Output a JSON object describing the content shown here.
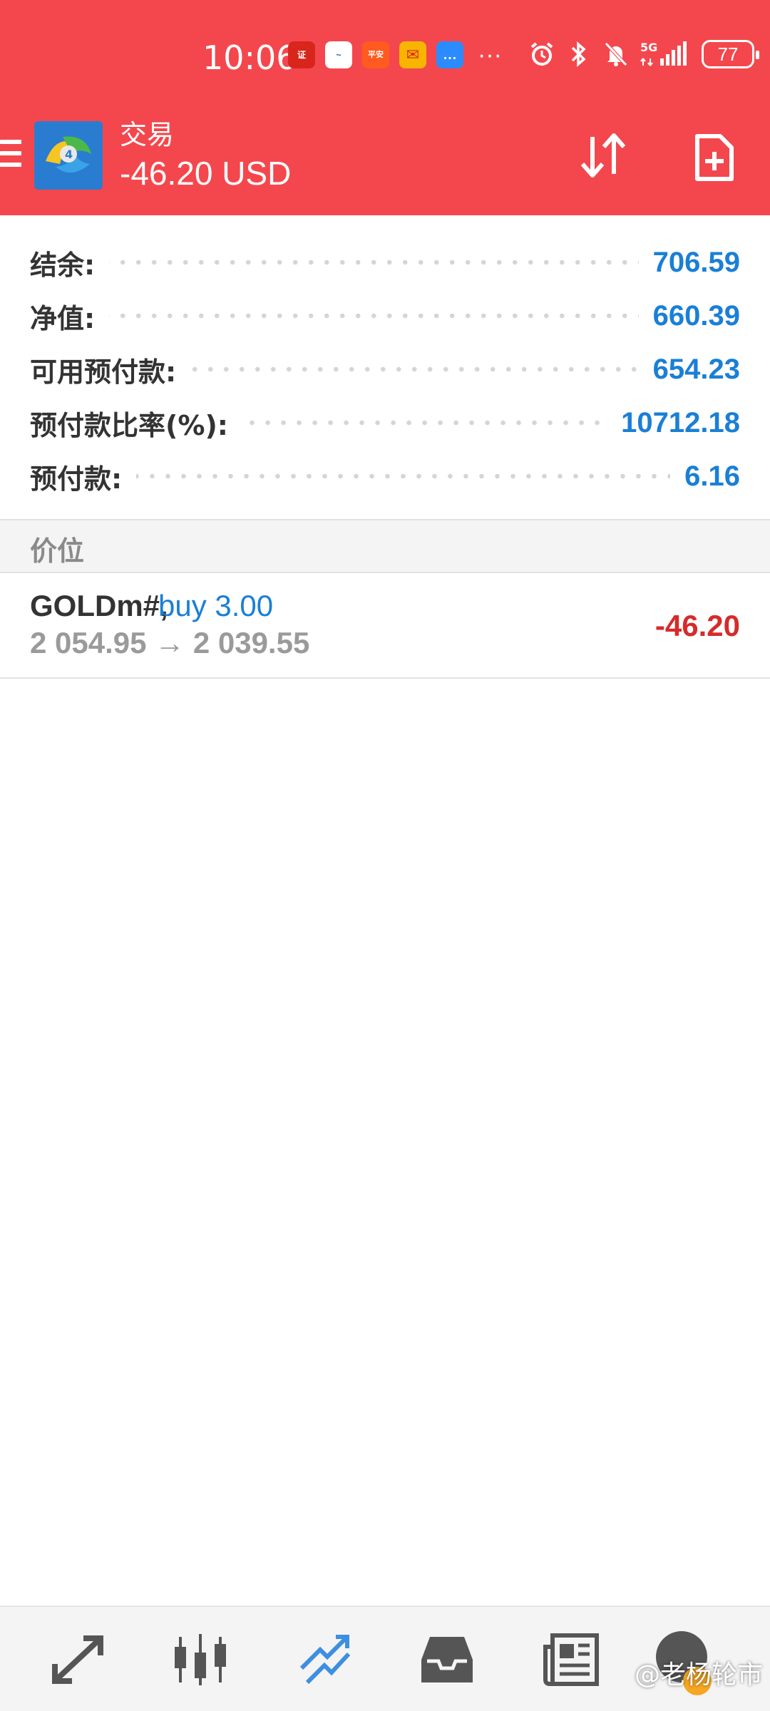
{
  "status_bar": {
    "time": "10:06",
    "notif_apps": [
      {
        "name": "app-securities",
        "color": "#d9261c",
        "glyph": "证"
      },
      {
        "name": "app-chart",
        "color": "#ffffff",
        "glyph": "~"
      },
      {
        "name": "app-pingan-bank",
        "color": "#ff5a1f",
        "glyph": "平安"
      },
      {
        "name": "app-mail",
        "color": "#f7b500",
        "glyph": "✉"
      },
      {
        "name": "app-messages",
        "color": "#2a8cff",
        "glyph": "…"
      }
    ],
    "more_notifications": "···",
    "network": "5G",
    "battery": "77"
  },
  "app_bar": {
    "title": "交易",
    "subtitle": "-46.20 USD"
  },
  "summary": [
    {
      "label": "结余:",
      "value": "706.59"
    },
    {
      "label": "净值:",
      "value": "660.39"
    },
    {
      "label": "可用预付款:",
      "value": "654.23"
    },
    {
      "label": "预付款比率(%):",
      "value": "10712.18"
    },
    {
      "label": "预付款:",
      "value": "6.16"
    }
  ],
  "section": {
    "title": "价位"
  },
  "position": {
    "symbol": "GOLDm#,",
    "side": "buy 3.00",
    "prices": "2 054.95 → 2 039.55",
    "profit": "-46.20"
  },
  "bottom_nav": {
    "items": [
      "quotes-icon",
      "chart-icon",
      "trade-icon",
      "history-icon",
      "news-icon"
    ],
    "active": "trade-icon",
    "active_color": "#3d8fe0",
    "inactive_color": "#555555"
  },
  "watermark": {
    "text": "@老杨轮市"
  },
  "colors": {
    "header": "#f4474d",
    "value_blue": "#1a7fd6",
    "loss_red": "#d62b2b"
  }
}
